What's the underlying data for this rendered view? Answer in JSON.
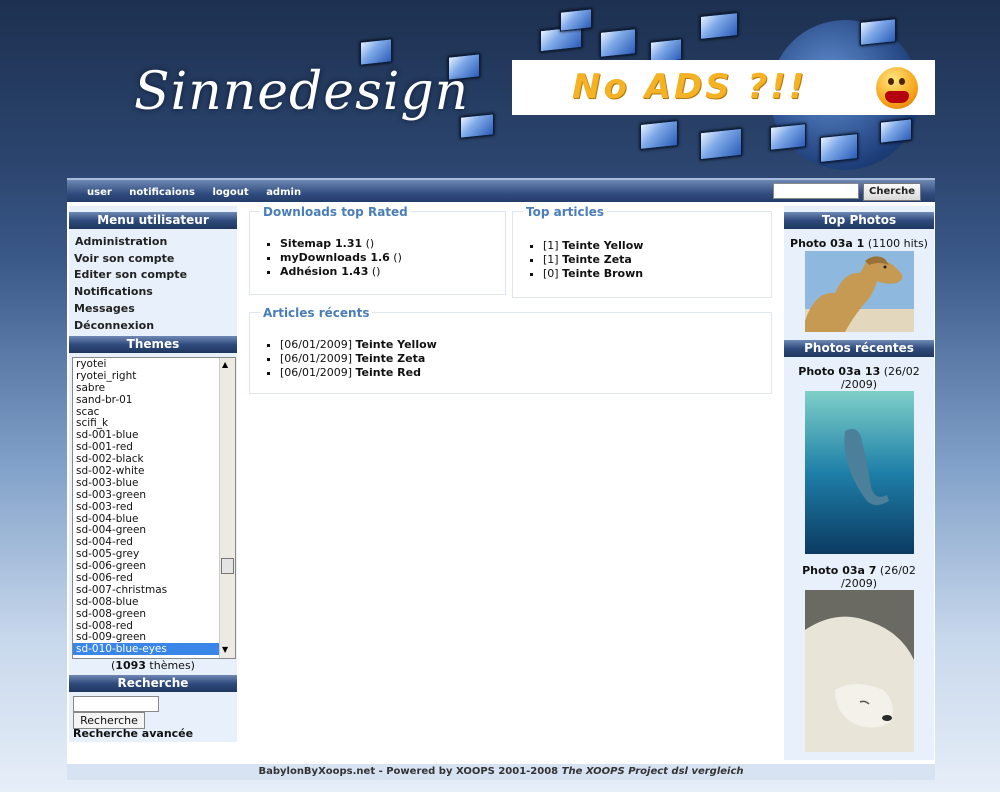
{
  "header": {
    "logo_text": "Sinnedesign",
    "ad_text": "No ADS ?!!"
  },
  "nav": {
    "links": [
      "user",
      "notificaions",
      "logout",
      "admin"
    ],
    "search_button": "Cherche"
  },
  "left": {
    "menu_title": "Menu utilisateur",
    "menu_items": [
      "Administration",
      "Voir son compte",
      "Editer son compte",
      "Notifications",
      "Messages",
      "Déconnexion"
    ],
    "themes_title": "Themes",
    "themes": [
      "ryotei",
      "ryotei_right",
      "sabre",
      "sand-br-01",
      "scac",
      "scifi_k",
      "sd-001-blue",
      "sd-001-red",
      "sd-002-black",
      "sd-002-white",
      "sd-003-blue",
      "sd-003-green",
      "sd-003-red",
      "sd-004-blue",
      "sd-004-green",
      "sd-004-red",
      "sd-005-grey",
      "sd-006-green",
      "sd-006-red",
      "sd-007-christmas",
      "sd-008-blue",
      "sd-008-green",
      "sd-008-red",
      "sd-009-green",
      "sd-010-blue-eyes"
    ],
    "selected_theme": "sd-010-blue-eyes",
    "theme_count": "1093",
    "theme_count_suffix": " thèmes)",
    "theme_count_prefix": "(",
    "search_title": "Recherche",
    "search_button": "Recherche",
    "advanced_search": "Recherche avancée"
  },
  "center": {
    "downloads": {
      "title": "Downloads top Rated",
      "items": [
        {
          "name": "Sitemap 1.31",
          "suffix": " ()"
        },
        {
          "name": "myDownloads 1.6",
          "suffix": " ()"
        },
        {
          "name": "Adhésion 1.43",
          "suffix": " ()"
        }
      ]
    },
    "top_articles": {
      "title": "Top articles",
      "items": [
        {
          "prefix": "[1] ",
          "name": "Teinte Yellow"
        },
        {
          "prefix": "[1] ",
          "name": "Teinte Zeta"
        },
        {
          "prefix": "[0] ",
          "name": "Teinte Brown"
        }
      ]
    },
    "recent_articles": {
      "title": "Articles récents",
      "items": [
        {
          "prefix": "[06/01/2009] ",
          "name": "Teinte Yellow"
        },
        {
          "prefix": "[06/01/2009] ",
          "name": "Teinte Zeta"
        },
        {
          "prefix": "[06/01/2009] ",
          "name": "Teinte Red"
        }
      ]
    }
  },
  "right": {
    "top_photos_title": "Top Photos",
    "top_photo": {
      "name": "Photo 03a 1",
      "meta": " (1100 hits)"
    },
    "recent_title": "Photos récentes",
    "recent_photos": [
      {
        "name": "Photo 03a 13",
        "meta1": " (26/02",
        "meta2": "/2009)"
      },
      {
        "name": "Photo 03a 7",
        "meta1": " (26/02",
        "meta2": "/2009)"
      }
    ]
  },
  "footer": {
    "text": "BabylonByXoops.net - Powered by XOOPS 2001-2008 ",
    "italic": "The XOOPS Project dsl vergleich"
  }
}
